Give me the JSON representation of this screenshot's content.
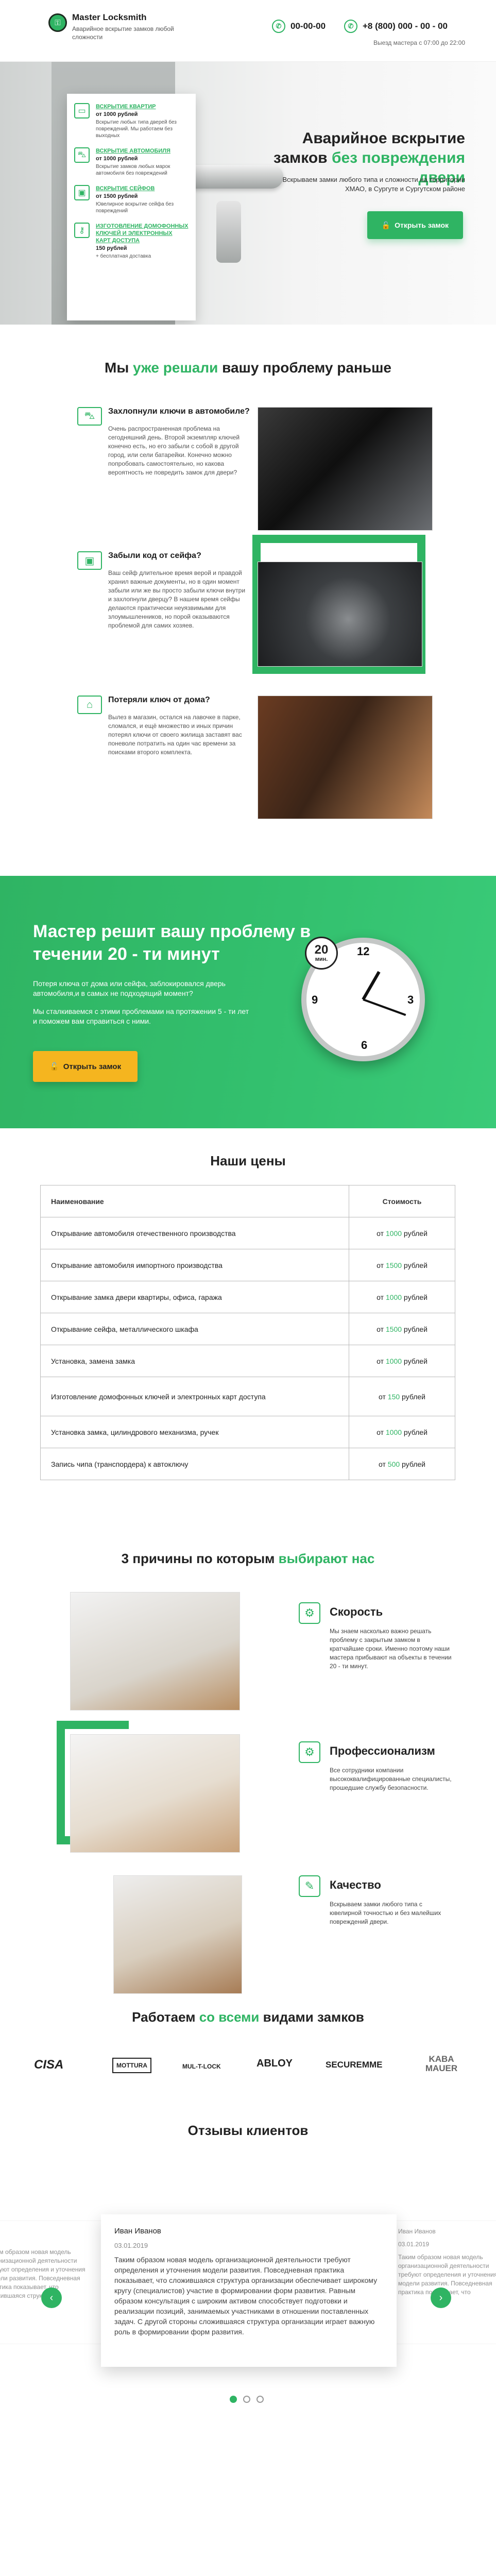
{
  "header": {
    "logo_mark": "⚿",
    "logo_title": "Master Locksmith",
    "logo_subtitle": "Аварийное вскрытие замков любой сложности",
    "phone1": "00-00-00",
    "phone2": "+8 (800) 000 - 00 - 00",
    "visit_text": "Выезд мастера с 07:00 до 22:00"
  },
  "hero": {
    "items": [
      {
        "icon": "car-icon",
        "title": "Вскрытие квартир",
        "price": "от 1000 рублей",
        "text": "Вскрытие любых типа дверей без повреждений. Мы работаем без выходных"
      },
      {
        "icon": "car-icon",
        "title": "Вскрытие автомобиля",
        "price": "от 1000 рублей",
        "text": "Вскрытие замков любых марок автомобиля без повреждений"
      },
      {
        "icon": "safe-icon",
        "title": "Вскрытие сейфов",
        "price": "от 1500 рублей",
        "text": "Ювелирное вскрытие сейфа без повреждений"
      },
      {
        "icon": "key-icon",
        "title": "Изготовление домофонных ключей и электронных карт доступа",
        "price": "150 рублей",
        "text": "+ бесплатная доставка"
      }
    ],
    "title_line1": "Аварийное вскрытие",
    "title_line2_a": "замков ",
    "title_line2_b": "без повреждения двери",
    "text": "Вскрываем замки любого типа и сложности на территории ХМАО, в Сургуте и Сургутском районе",
    "button": "Открыть замок"
  },
  "problems": {
    "title_a": "Мы ",
    "title_b": "уже решали",
    "title_c": " вашу проблему раньше",
    "items": [
      {
        "title": "Захлопнули ключи в автомобиле?",
        "text": "Очень распространенная проблема на сегодняшний день. Второй экземпляр ключей конечно есть, но его забыли с собой в другой город, или сели батарейки. Конечно можно попробовать самостоятельно, но какова вероятность не повредить замок для двери?"
      },
      {
        "title": "Забыли код от сейфа?",
        "text": "Ваш сейф длительное время верой и правдой хранил важные документы, но в один момент забыли или же вы просто забыли ключи внутри и захлопнули дверцу? В нашем время сейфы делаются практически неуязвимыми для злоумышленников, но порой оказываются проблемой для самих хозяев."
      },
      {
        "title": "Потеряли ключ от дома?",
        "text": "Вылез в магазин, остался на лавочке в парке, сломался, и ещё множество и иных причин потерял ключи от своего жилища заставят вас поневоле потратить на один час времени за поисками второго комплекта."
      }
    ]
  },
  "master": {
    "title": "Мастер решит вашу проблему в течении 20 - ти минут",
    "text1": "Потеря ключа от дома или сейфа, заблокировался дверь автомобиля,и в самых не подходящий момент?",
    "text2": "Мы сталкиваемся с этими проблемами на протяжении 5 - ти лет и поможем вам справиться с ними.",
    "button": "Открыть замок",
    "badge_number": "20",
    "badge_unit": "мин."
  },
  "prices": {
    "title": "Наши цены",
    "col_name": "Наименование",
    "col_price": "Стоимость",
    "rows": [
      {
        "name": "Открывание автомобиля отечественного производства",
        "pre": "от ",
        "num": "1000",
        "post": " рублей"
      },
      {
        "name": "Открывание автомобиля импортного производства",
        "pre": "от ",
        "num": "1500",
        "post": " рублей"
      },
      {
        "name": "Открывание замка двери квартиры, офиса, гаража",
        "pre": "от ",
        "num": "1000",
        "post": " рублей"
      },
      {
        "name": "Открывание сейфа, металлического шкафа",
        "pre": "от ",
        "num": "1500",
        "post": " рублей"
      },
      {
        "name": "Установка, замена замка",
        "pre": "от ",
        "num": "1000",
        "post": " рублей"
      },
      {
        "name": "Изготовление домофонных ключей и электронных карт доступа",
        "pre": "от ",
        "num": "150",
        "post": " рублей"
      },
      {
        "name": "Установка замка, цилиндрового механизма, ручек",
        "pre": "от ",
        "num": "1000",
        "post": " рублей"
      },
      {
        "name": "Запись чипа (транспордера) к автоключу",
        "pre": "от ",
        "num": "500",
        "post": " рублей"
      }
    ]
  },
  "reasons": {
    "title_a": "3 причины по которым ",
    "title_b": "выбирают нас",
    "items": [
      {
        "title": "Скорость",
        "text": "Мы знаем насколько важно решать проблему с закрытым замком в кратчайшие сроки. Именно поэтому наши мастера прибывают на объекты в течении 20 - ти минут."
      },
      {
        "title": "Профессионализм",
        "text": "Все сотрудники компании высококвалифицированные специалисты, прошедшие службу безопасности."
      },
      {
        "title": "Качество",
        "text": "Вскрываем замки любого типа с ювелирной точностью и без малейших повреждений двери."
      }
    ]
  },
  "brands": {
    "title_a": "Работаем ",
    "title_b": "со всеми",
    "title_c": " видами замков",
    "items": [
      "CISA",
      "MOTTURA",
      "MUL-T-LOCK",
      "ABLOY",
      "SECUREMME",
      "KABA MAUER"
    ]
  },
  "reviews": {
    "title": "Отзывы клиентов",
    "name": "Иван Иванов",
    "date": "03.01.2019",
    "text": "Таким образом новая модель организационной деятельности требуют определения и уточнения модели развития. Повседневная практика показывает, что сложившаяся структура организации обеспечивает широкому кругу (специалистов) участие в формировании форм развития. Равным образом консультация с широким активом способствует подготовки и реализации позиций, занимаемых участниками в отношении поставленных задач. С другой стороны сложившаяся структура организации играет важную роль в формировании форм развития.",
    "left_text": "Таким образом новая модель организационной деятельности требуют определения и уточнения модели развития. Повседневная практика показывает, что сложившаяся структура",
    "right_name": "Иван Иванов",
    "right_date": "03.01.2019",
    "right_text": "Таким образом новая модель организационной деятельности требуют определения и уточнения модели развития. Повседневная практика показывает, что"
  }
}
